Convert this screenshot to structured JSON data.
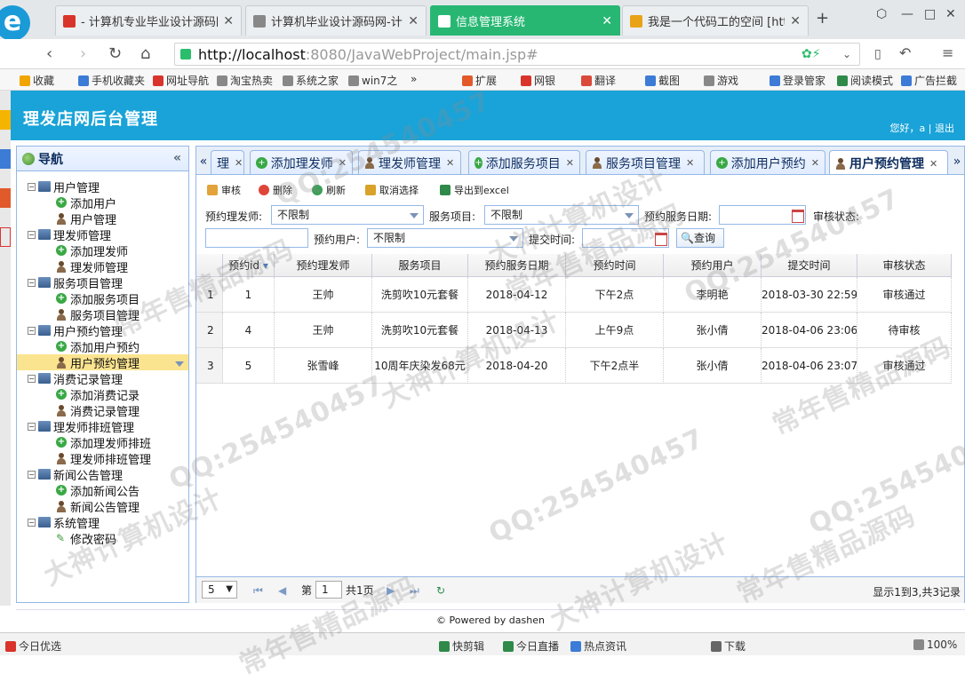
{
  "browser": {
    "tabs": [
      {
        "title": "- 计算机专业毕业设计源码网",
        "color": "#d9342b"
      },
      {
        "title": "计算机毕业设计源码网-计算",
        "color": "#888888"
      },
      {
        "title": "信息管理系统",
        "color": "#27b773"
      },
      {
        "title": "我是一个代码工的空间 [http",
        "color": "#e8a317"
      }
    ],
    "new_tab": "+",
    "url_host": "http://localhost",
    "url_path": ":8080/JavaWebProject/main.jsp#",
    "bookmarks": [
      "收藏",
      "手机收藏夹",
      "网址导航",
      "淘宝热卖",
      "系统之家",
      "win7之",
      "扩展",
      "网银",
      "翻译",
      "截图",
      "游戏",
      "登录管家",
      "阅读模式",
      "广告拦截"
    ],
    "overflow": "»"
  },
  "app": {
    "title": "理发店网后台管理",
    "greeting": "您好，a | 退出"
  },
  "nav": {
    "title": "导航",
    "collapse": "«",
    "groups": [
      {
        "label": "用户管理",
        "items": [
          {
            "label": "添加用户",
            "icon": "add"
          },
          {
            "label": "用户管理",
            "icon": "user"
          }
        ]
      },
      {
        "label": "理发师管理",
        "items": [
          {
            "label": "添加理发师",
            "icon": "add"
          },
          {
            "label": "理发师管理",
            "icon": "user"
          }
        ]
      },
      {
        "label": "服务项目管理",
        "items": [
          {
            "label": "添加服务项目",
            "icon": "add"
          },
          {
            "label": "服务项目管理",
            "icon": "user"
          }
        ]
      },
      {
        "label": "用户预约管理",
        "items": [
          {
            "label": "添加用户预约",
            "icon": "add"
          },
          {
            "label": "用户预约管理",
            "icon": "user",
            "selected": true
          }
        ]
      },
      {
        "label": "消费记录管理",
        "items": [
          {
            "label": "添加消费记录",
            "icon": "add"
          },
          {
            "label": "消费记录管理",
            "icon": "user"
          }
        ]
      },
      {
        "label": "理发师排班管理",
        "items": [
          {
            "label": "添加理发师排班",
            "icon": "add"
          },
          {
            "label": "理发师排班管理",
            "icon": "user"
          }
        ]
      },
      {
        "label": "新闻公告管理",
        "items": [
          {
            "label": "添加新闻公告",
            "icon": "add"
          },
          {
            "label": "新闻公告管理",
            "icon": "user"
          }
        ]
      },
      {
        "label": "系统管理",
        "items": [
          {
            "label": "修改密码",
            "icon": "pen"
          }
        ]
      }
    ]
  },
  "page_tabs": [
    {
      "label": "理",
      "icon": "none"
    },
    {
      "label": "添加理发师",
      "icon": "add"
    },
    {
      "label": "理发师管理",
      "icon": "user"
    },
    {
      "label": "添加服务项目",
      "icon": "add"
    },
    {
      "label": "服务项目管理",
      "icon": "user"
    },
    {
      "label": "添加用户预约",
      "icon": "add"
    },
    {
      "label": "用户预约管理",
      "icon": "user",
      "active": true
    }
  ],
  "tab_scroll_left": "«",
  "tab_scroll_right": "»",
  "toolbar": {
    "audit": "审核",
    "delete": "删除",
    "refresh": "刷新",
    "unselect": "取消选择",
    "export": "导出到excel"
  },
  "filters": {
    "barber_label": "预约理发师:",
    "barber_value": "不限制",
    "service_label": "服务项目:",
    "service_value": "不限制",
    "date_label": "预约服务日期:",
    "date_value": "",
    "status_label": "审核状态:",
    "status_value": "",
    "user_label": "预约用户:",
    "user_value": "不限制",
    "submit_label": "提交时间:",
    "submit_value": "",
    "query": "查询"
  },
  "table": {
    "columns": [
      "预约id",
      "预约理发师",
      "服务项目",
      "预约服务日期",
      "预约时间",
      "预约用户",
      "提交时间",
      "审核状态"
    ],
    "rows": [
      [
        "1",
        "1",
        "王帅",
        "洗剪吹10元套餐",
        "2018-04-12",
        "下午2点",
        "李明艳",
        "2018-03-30 22:59",
        "审核通过"
      ],
      [
        "2",
        "4",
        "王帅",
        "洗剪吹10元套餐",
        "2018-04-13",
        "上午9点",
        "张小倩",
        "2018-04-06 23:06",
        "待审核"
      ],
      [
        "3",
        "5",
        "张雪峰",
        "10周年庆染发68元",
        "2018-04-20",
        "下午2点半",
        "张小倩",
        "2018-04-06 23:07",
        "审核通过"
      ]
    ]
  },
  "pager": {
    "page_size": "5",
    "page_prefix": "第",
    "page_value": "1",
    "page_total": "共1页",
    "summary": "显示1到3,共3记录"
  },
  "footer": "© Powered by dashen",
  "statusbar": [
    "今日优选",
    "快剪辑",
    "今日直播",
    "热点资讯",
    "下载",
    "100%"
  ],
  "watermarks": [
    "QQ:254540457",
    "大神计算机设计",
    "常年售精品源码"
  ]
}
